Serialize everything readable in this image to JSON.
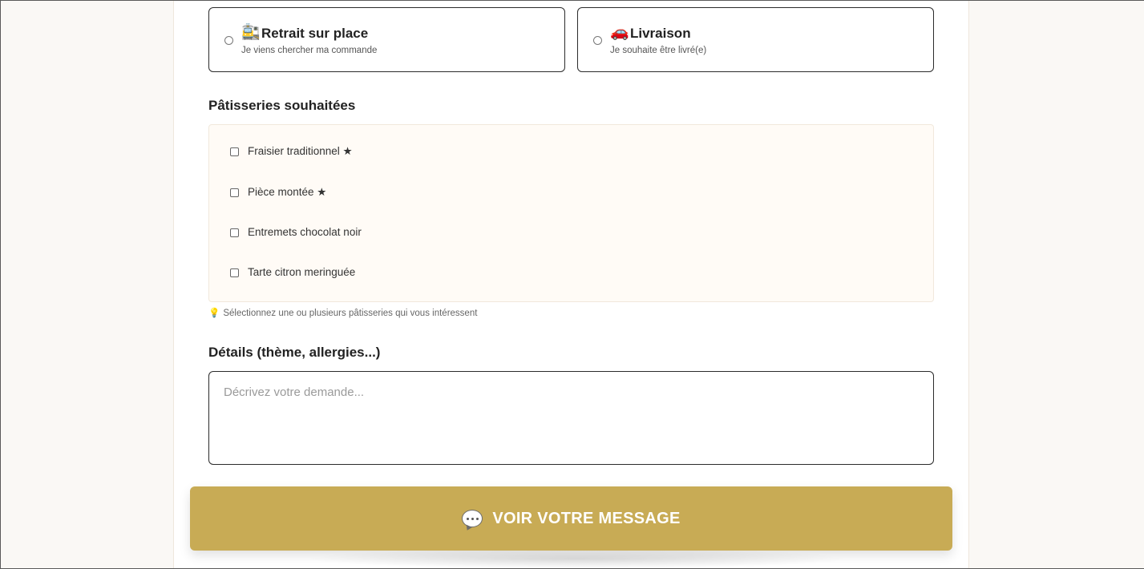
{
  "delivery": {
    "options": [
      {
        "icon": "🚉",
        "icon_name": "pickup-station-icon",
        "title": "Retrait sur place",
        "subtitle": "Je viens chercher ma commande",
        "selected": false
      },
      {
        "icon": "🚗",
        "icon_name": "car-icon",
        "title": "Livraison",
        "subtitle": "Je souhaite être livré(e)",
        "selected": false
      }
    ]
  },
  "pastries": {
    "title": "Pâtisseries souhaitées",
    "items": [
      {
        "label": "Fraisier traditionnel ★",
        "checked": false
      },
      {
        "label": "Pièce montée ★",
        "checked": false
      },
      {
        "label": "Entremets chocolat noir",
        "checked": false
      },
      {
        "label": "Tarte citron meringuée",
        "checked": false
      }
    ],
    "hint_icon": "💡",
    "hint_icon_name": "lightbulb-icon",
    "hint": "Sélectionnez une ou plusieurs pâtisseries qui vous intéressent"
  },
  "details": {
    "title": "Détails (thème, allergies...)",
    "value": "",
    "placeholder": "Décrivez votre demande..."
  },
  "submit": {
    "icon_name": "speech-bubble-icon",
    "label": "VOIR VOTRE MESSAGE"
  },
  "colors": {
    "accent": "#c8ab55",
    "background": "#faf8f5",
    "checklist_background": "#fffbf6",
    "border": "#2b2b2b"
  }
}
